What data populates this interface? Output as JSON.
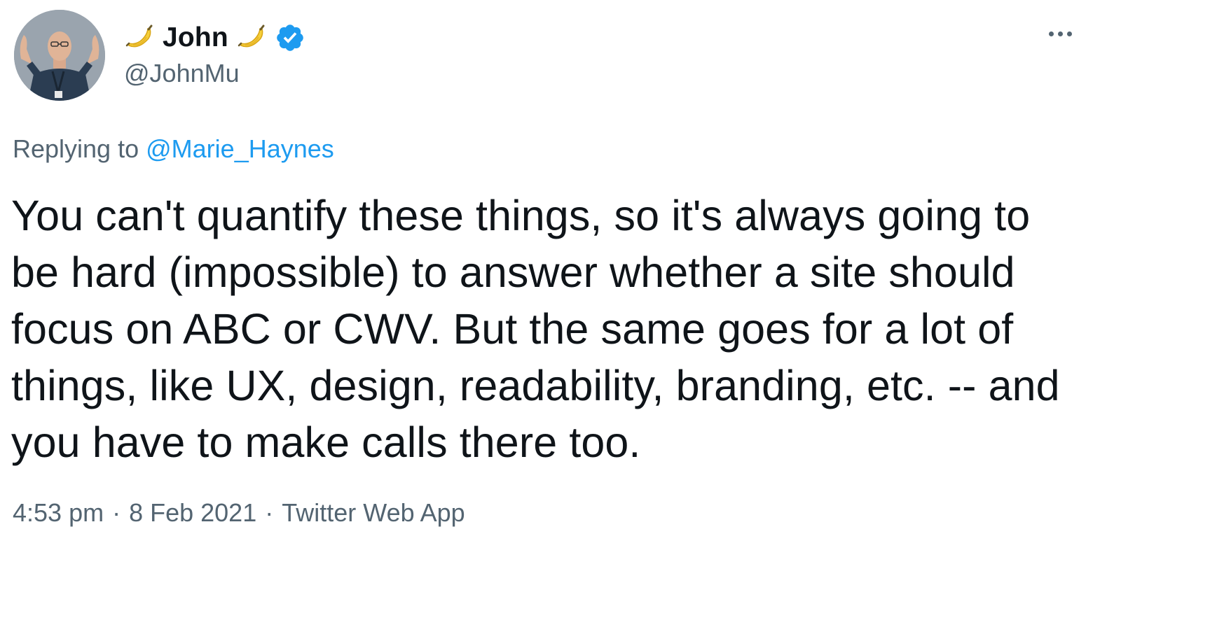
{
  "tweet": {
    "display_name": "John",
    "name_emoji_left": "banana-emoji",
    "name_emoji_right": "banana-emoji",
    "verified_icon": "verified-badge-icon",
    "handle": "@JohnMu",
    "more_icon": "more-options-icon",
    "reply_prefix": "Replying to",
    "reply_mention": "@Marie_Haynes",
    "text": "You can't quantify these things, so it's always going to be hard (impossible) to answer whether a site should focus on ABC or CWV. But the same goes for a lot of things, like UX, design, readability, branding, etc. -- and you have to make calls there too.",
    "time": "4:53 pm",
    "separator": "·",
    "date": "8 Feb 2021",
    "source": "Twitter Web App"
  },
  "colors": {
    "text_primary": "#0f1419",
    "text_secondary": "#536471",
    "link": "#1d9bf0",
    "verified": "#1d9bf0"
  }
}
